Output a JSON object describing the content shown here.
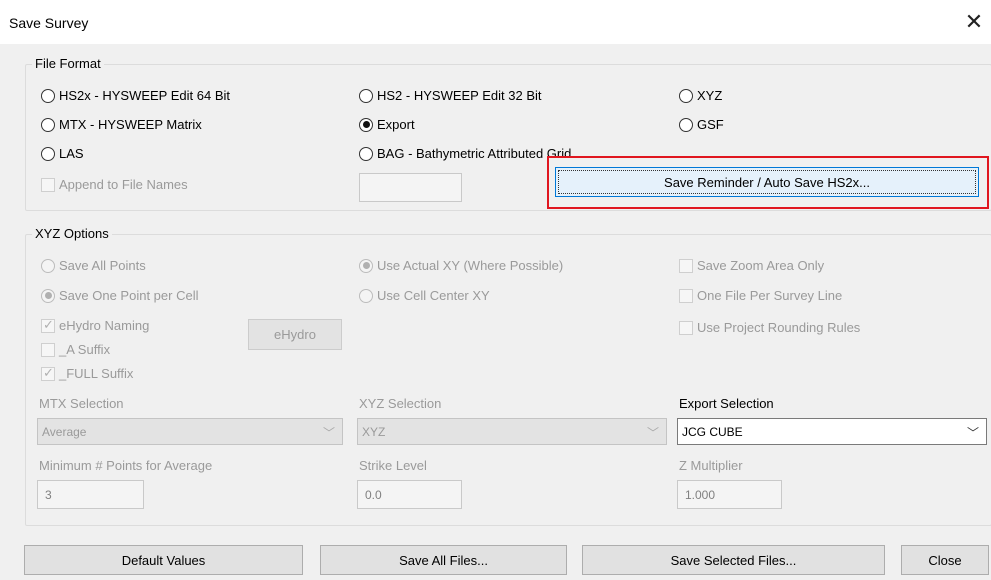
{
  "window": {
    "title": "Save Survey",
    "close_glyph": "✕"
  },
  "file_format": {
    "legend": "File Format",
    "options": {
      "hs2x": "HS2x - HYSWEEP Edit 64 Bit",
      "hs2": "HS2 - HYSWEEP Edit 32 Bit",
      "xyz": "XYZ",
      "mtx": "MTX - HYSWEEP Matrix",
      "export": "Export",
      "gsf": "GSF",
      "las": "LAS",
      "bag": "BAG - Bathymetric Attributed Grid"
    },
    "selected": "export",
    "append_label": "Append to File Names",
    "append_value": "",
    "save_reminder_button": "Save Reminder / Auto Save HS2x..."
  },
  "xyz_options": {
    "legend": "XYZ Options",
    "save_all_points": "Save All Points",
    "save_one_point": "Save One Point per Cell",
    "use_actual_xy": "Use Actual XY (Where Possible)",
    "use_cell_center": "Use Cell Center XY",
    "save_zoom_area": "Save Zoom Area Only",
    "one_file_per_line": "One File Per Survey Line",
    "use_rounding": "Use Project Rounding Rules",
    "ehydro_naming": "eHydro Naming",
    "a_suffix": "_A Suffix",
    "full_suffix": "_FULL Suffix",
    "ehydro_button": "eHydro",
    "mtx_selection_label": "MTX Selection",
    "mtx_selection_value": "Average",
    "xyz_selection_label": "XYZ Selection",
    "xyz_selection_value": "XYZ",
    "export_selection_label": "Export Selection",
    "export_selection_value": "JCG CUBE",
    "min_points_label": "Minimum # Points for Average",
    "min_points_value": "3",
    "strike_level_label": "Strike Level",
    "strike_level_value": "0.0",
    "z_multiplier_label": "Z Multiplier",
    "z_multiplier_value": "1.000"
  },
  "footer": {
    "default_values": "Default Values",
    "save_all_files": "Save All Files...",
    "save_selected_files": "Save Selected Files...",
    "close": "Close"
  },
  "colors": {
    "highlight": "#e0161f",
    "focus": "#0078d7",
    "dialog_bg": "#f0f0f0"
  }
}
